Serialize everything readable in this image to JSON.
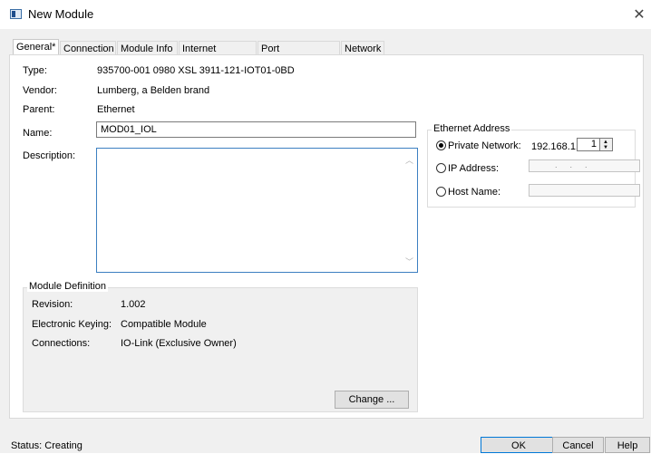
{
  "window": {
    "title": "New Module",
    "close_glyph": "✕"
  },
  "tabs": [
    {
      "label": "General*",
      "active": true
    },
    {
      "label": "Connection"
    },
    {
      "label": "Module Info"
    },
    {
      "label": "Internet Protocol"
    },
    {
      "label": "Port Configuration"
    },
    {
      "label": "Network"
    }
  ],
  "general": {
    "type_label": "Type:",
    "type_value": "935700-001 0980 XSL 3911-121-IOT01-0BD",
    "vendor_label": "Vendor:",
    "vendor_value": "Lumberg, a Belden brand",
    "parent_label": "Parent:",
    "parent_value": "Ethernet",
    "name_label": "Name:",
    "name_value": "MOD01_IOL",
    "description_label": "Description:",
    "description_value": ""
  },
  "ethernet_address": {
    "title": "Ethernet Address",
    "private_network_label": "Private Network:",
    "private_network_prefix": "192.168.1.",
    "private_network_value": "1",
    "ip_address_label": "IP Address:",
    "ip_address_value": "",
    "host_name_label": "Host Name:",
    "host_name_value": "",
    "selected": "private_network"
  },
  "module_definition": {
    "title": "Module Definition",
    "revision_label": "Revision:",
    "revision_value": "1.002",
    "keying_label": "Electronic Keying:",
    "keying_value": "Compatible Module",
    "connections_label": "Connections:",
    "connections_value": "IO-Link (Exclusive Owner)",
    "change_button": "Change ..."
  },
  "status": {
    "text": "Status: Creating"
  },
  "buttons": {
    "ok": "OK",
    "cancel": "Cancel",
    "help": "Help"
  },
  "colors": {
    "focus_border": "#3c7fc1",
    "default_button_border": "#0078d7",
    "dialog_bg": "#f0f0f0"
  }
}
